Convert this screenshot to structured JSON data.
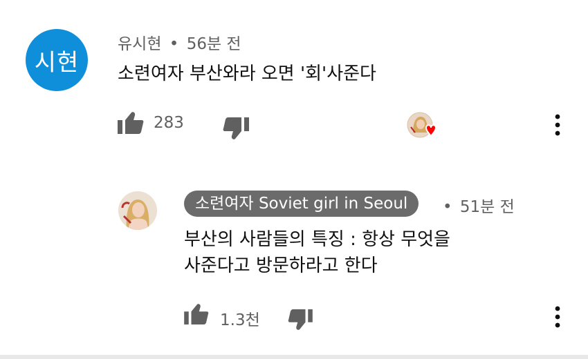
{
  "comment": {
    "avatar_text": "시현",
    "author": "유시현",
    "separator": "•",
    "time": "56분 전",
    "text": "소련여자 부산와라 오면 '회'사준다",
    "like_count": "283",
    "icons": [
      "thumb-up-icon",
      "thumb-down-icon",
      "creator-heart-icon",
      "more-options-icon"
    ],
    "avatar_color": "#0f8fd9",
    "heart_color": "#ff0000"
  },
  "reply": {
    "author": "소련여자 Soviet girl in Seoul",
    "separator": "•",
    "time": "51분 전",
    "text_line1": "부산의 사람들의 특징 : 항상 무엇을",
    "text_line2": "사준다고 방문하라고 한다",
    "like_count": "1.3천",
    "icons": [
      "thumb-up-icon",
      "thumb-down-icon",
      "more-options-icon"
    ],
    "chip_color": "#6b6b6b"
  }
}
